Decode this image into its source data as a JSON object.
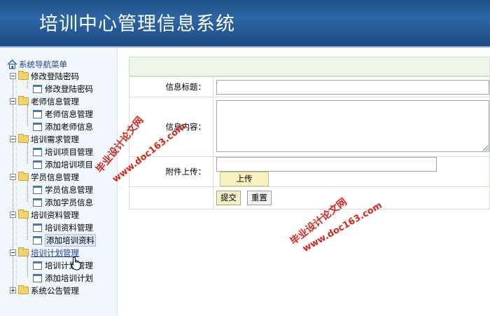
{
  "header": {
    "title": "培训中心管理信息系统"
  },
  "sidebar": {
    "root_label": "系统导航菜单",
    "groups": [
      {
        "label": "修改登陆密码",
        "items": [
          "修改登陆密码"
        ]
      },
      {
        "label": "老师信息管理",
        "items": [
          "老师信息管理",
          "添加老师信息"
        ]
      },
      {
        "label": "培训需求管理",
        "items": [
          "培训项目管理",
          "添加培训项目"
        ]
      },
      {
        "label": "学员信息管理",
        "items": [
          "学员信息管理",
          "添加学员信息"
        ]
      },
      {
        "label": "培训资料管理",
        "items": [
          "培训资料管理",
          "添加培训资料"
        ]
      },
      {
        "label": "培训计划管理",
        "items": [
          "培训计划管理",
          "添加培训计划"
        ]
      },
      {
        "label": "系统公告管理",
        "items": []
      }
    ]
  },
  "form": {
    "title_label": "信息标题：",
    "title_value": "",
    "content_label": "信息内容：",
    "content_value": "",
    "attachment_label": "附件上传：",
    "attachment_value": "",
    "upload_label": "上传",
    "submit_label": "提交",
    "reset_label": "重置"
  },
  "watermarks": {
    "line1": "毕业设计论文网",
    "line2": "www.doc163.com"
  },
  "colors": {
    "header": "#2b66a6",
    "watermark": "#d9251e",
    "sidebar": "#f2f7fd"
  }
}
